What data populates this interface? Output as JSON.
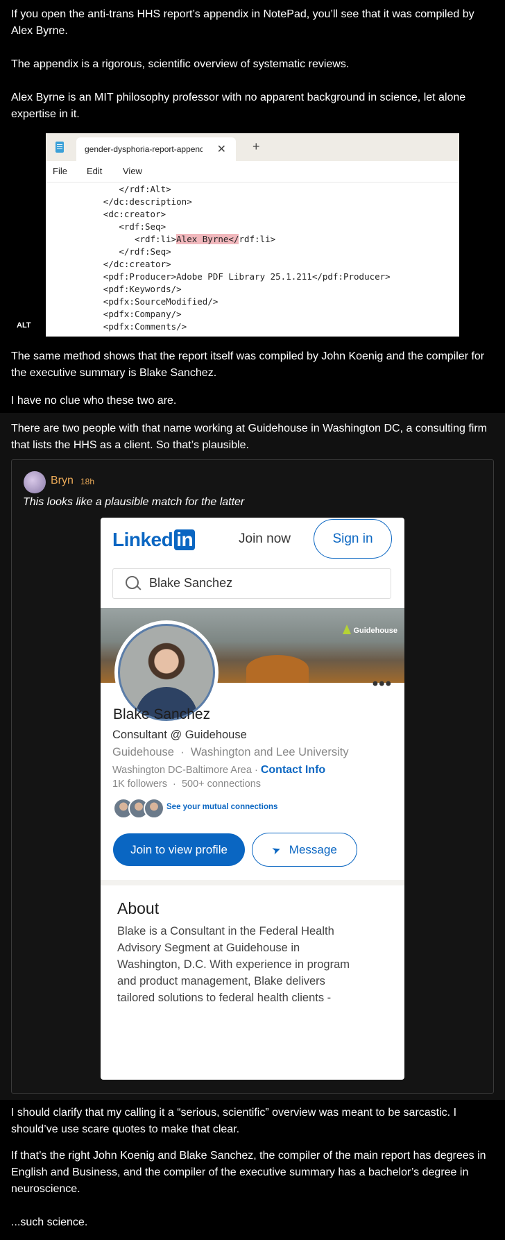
{
  "post": {
    "p1": "If you open the anti-trans HHS report’s appendix in NotePad, you’ll see that it was compiled by Alex Byrne.",
    "p2": "The appendix is a rigorous, scientific overview of systematic reviews.",
    "p3": "Alex Byrne is an MIT philosophy professor with no apparent background in science, let alone expertise in it.",
    "alt_badge": "ALT",
    "p4": "The same method shows that the report itself was compiled by John Koenig and the compiler for the executive summary is Blake Sanchez.",
    "p5": "I have no clue who these two are.",
    "p6": "There are two people with that name working at Guidehouse in Washington DC, a consulting firm that lists the HHS as a client. So that’s plausible.",
    "p7": "I should clarify that my calling it a “serious, scientific” overview was meant to be sarcastic. I should’ve use scare quotes to make that clear.",
    "p8": "If that’s the right John Koenig and Blake Sanchez, the compiler of the main report has degrees in English and Business, and the compiler of the executive summary has a bachelor’s degree in neuroscience.",
    "p9": "...such science."
  },
  "notepad": {
    "tab_title": "gender-dysphoria-report-appendi",
    "close_glyph": "✕",
    "plus_glyph": "+",
    "menu": [
      "File",
      "Edit",
      "View"
    ],
    "lines": [
      {
        "indent": "         ",
        "pre": "</rdf:Alt>",
        "hl": "",
        "post": ""
      },
      {
        "indent": "      ",
        "pre": "</dc:description>",
        "hl": "",
        "post": ""
      },
      {
        "indent": "      ",
        "pre": "<dc:creator>",
        "hl": "",
        "post": ""
      },
      {
        "indent": "         ",
        "pre": "<rdf:Seq>",
        "hl": "",
        "post": ""
      },
      {
        "indent": "            ",
        "pre": "<rdf:li>",
        "hl": "Alex Byrne</",
        "post": "rdf:li>"
      },
      {
        "indent": "         ",
        "pre": "</rdf:Seq>",
        "hl": "",
        "post": ""
      },
      {
        "indent": "      ",
        "pre": "</dc:creator>",
        "hl": "",
        "post": ""
      },
      {
        "indent": "      ",
        "pre": "<pdf:Producer>Adobe PDF Library 25.1.211</pdf:Producer>",
        "hl": "",
        "post": ""
      },
      {
        "indent": "      ",
        "pre": "<pdf:Keywords/>",
        "hl": "",
        "post": ""
      },
      {
        "indent": "      ",
        "pre": "<pdfx:SourceModified/>",
        "hl": "",
        "post": ""
      },
      {
        "indent": "      ",
        "pre": "<pdfx:Company/>",
        "hl": "",
        "post": ""
      },
      {
        "indent": "      ",
        "pre": "<pdfx:Comments/>",
        "hl": "",
        "post": ""
      }
    ]
  },
  "quote": {
    "author": "Bryn",
    "time": "18h",
    "text": "This looks like a plausible match for the latter"
  },
  "linkedin": {
    "logo_text": "Linked",
    "logo_in": "in",
    "join_now": "Join now",
    "sign_in": "Sign in",
    "search_value": "Blake Sanchez",
    "banner_brand": "Guidehouse",
    "more": "•••",
    "name": "Blake Sanchez",
    "headline": "Consultant @ Guidehouse",
    "company": "Guidehouse",
    "dot": "·",
    "school": "Washington and Lee University",
    "location": "Washington DC-Baltimore Area",
    "contact": "Contact Info",
    "followers": "1K followers",
    "connections": "500+ connections",
    "mutual": "See your mutual connections",
    "join_profile": "Join to view profile",
    "message": "Message",
    "about_heading": "About",
    "about_text": "Blake is a Consultant in the Federal Health Advisory Segment at Guidehouse in Washington, D.C. With experience in program and product management, Blake delivers tailored solutions to federal health clients -"
  }
}
